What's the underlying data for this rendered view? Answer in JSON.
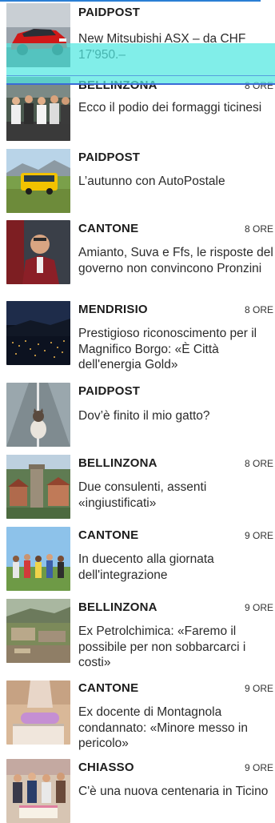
{
  "articles": [
    {
      "category": "PAIDPOST",
      "time": "",
      "headline": "New Mitsubishi ASX – da CHF 17'950.–",
      "thumb": "red-car-photo"
    },
    {
      "category": "BELLINZONA",
      "time": "8 ORE",
      "headline": "Ecco il podio dei formaggi ticinesi",
      "thumb": "group-photo"
    },
    {
      "category": "PAIDPOST",
      "time": "",
      "headline": "L’autunno con AutoPostale",
      "thumb": "yellow-bus-photo"
    },
    {
      "category": "CANTONE",
      "time": "8 ORE",
      "headline": "Amianto, Suva e Ffs, le risposte del governo non convincono Pronzini",
      "thumb": "politician-photo"
    },
    {
      "category": "MENDRISIO",
      "time": "8 ORE",
      "headline": "Prestigioso riconoscimento per il Magnifico Borgo: «È Città dell'energia Gold»",
      "thumb": "night-city-photo"
    },
    {
      "category": "PAIDPOST",
      "time": "",
      "headline": "Dov’è finito il mio gatto?",
      "thumb": "cat-on-road-photo"
    },
    {
      "category": "BELLINZONA",
      "time": "8 ORE",
      "headline": "Due consulenti, assenti «ingiustificati»",
      "thumb": "castle-photo"
    },
    {
      "category": "CANTONE",
      "time": "9 ORE",
      "headline": "In duecento alla giornata dell'integrazione",
      "thumb": "people-outdoors-photo"
    },
    {
      "category": "BELLINZONA",
      "time": "9 ORE",
      "headline": "Ex Petrolchimica: «Faremo il possibile per non sobbarcarci i costi»",
      "thumb": "industrial-site-photo"
    },
    {
      "category": "CANTONE",
      "time": "9 ORE",
      "headline": "Ex docente di Montagnola condannato: «Minore messo in pericolo»",
      "thumb": "pencil-case-photo"
    },
    {
      "category": "CHIASSO",
      "time": "9 ORE",
      "headline": "C'è una nuova centenaria in Ticino",
      "thumb": "birthday-photo"
    }
  ]
}
